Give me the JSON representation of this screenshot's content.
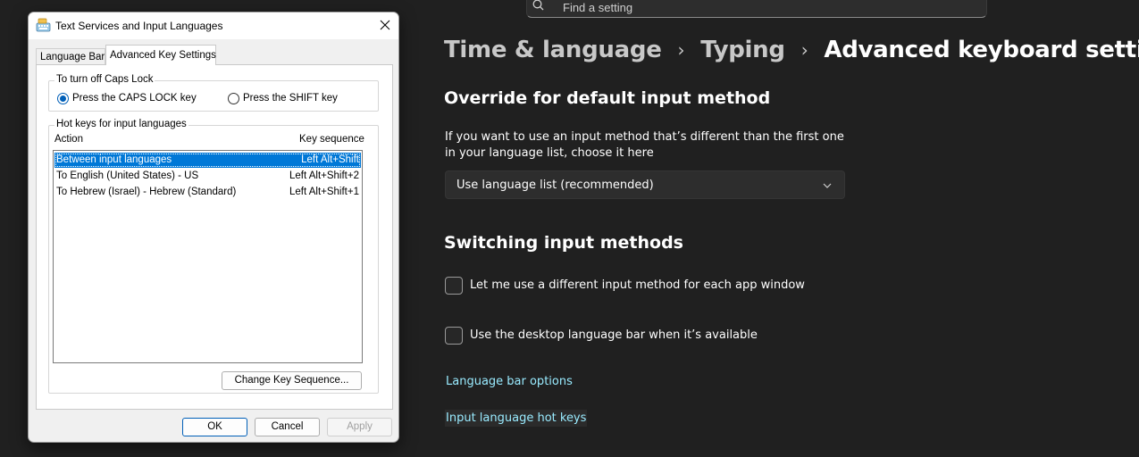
{
  "settings": {
    "search": {
      "placeholder": "Find a setting"
    },
    "breadcrumb": [
      "Time & language",
      "Typing",
      "Advanced keyboard settings"
    ],
    "override": {
      "title": "Override for default input method",
      "description": "If you want to use an input method that’s different than the first one in your language list, choose it here",
      "dropdown_value": "Use language list (recommended)"
    },
    "switching": {
      "title": "Switching input methods",
      "checkbox_per_app": {
        "label": "Let me use a different input method for each app window",
        "checked": false
      },
      "checkbox_language_bar": {
        "label": "Use the desktop language bar when it’s available",
        "checked": false
      }
    },
    "links": {
      "language_bar_options": "Language bar options",
      "input_language_hot_keys": "Input language hot keys"
    },
    "colors": {
      "background": "#202020",
      "link": "#99ebff"
    }
  },
  "dialog": {
    "title": "Text Services and Input Languages",
    "tabs": [
      "Language Bar",
      "Advanced Key Settings"
    ],
    "active_tab": "Advanced Key Settings",
    "caps_lock_group": {
      "legend": "To turn off Caps Lock",
      "option_caps": "Press the CAPS LOCK key",
      "option_shift": "Press the SHIFT key",
      "selected": "Press the CAPS LOCK key"
    },
    "hotkeys_group": {
      "legend": "Hot keys for input languages",
      "col_action": "Action",
      "col_key": "Key sequence",
      "rows": [
        {
          "action": "Between input languages",
          "key": "Left Alt+Shift",
          "selected": true
        },
        {
          "action": "To English (United States) - US",
          "key": "Left Alt+Shift+2",
          "selected": false
        },
        {
          "action": "To Hebrew (Israel) - Hebrew (Standard)",
          "key": "Left Alt+Shift+1",
          "selected": false
        }
      ],
      "change_button": "Change Key Sequence..."
    },
    "buttons": {
      "ok": "OK",
      "cancel": "Cancel",
      "apply": "Apply"
    },
    "colors": {
      "selection": "#0078d7",
      "accent": "#005fb8"
    }
  }
}
